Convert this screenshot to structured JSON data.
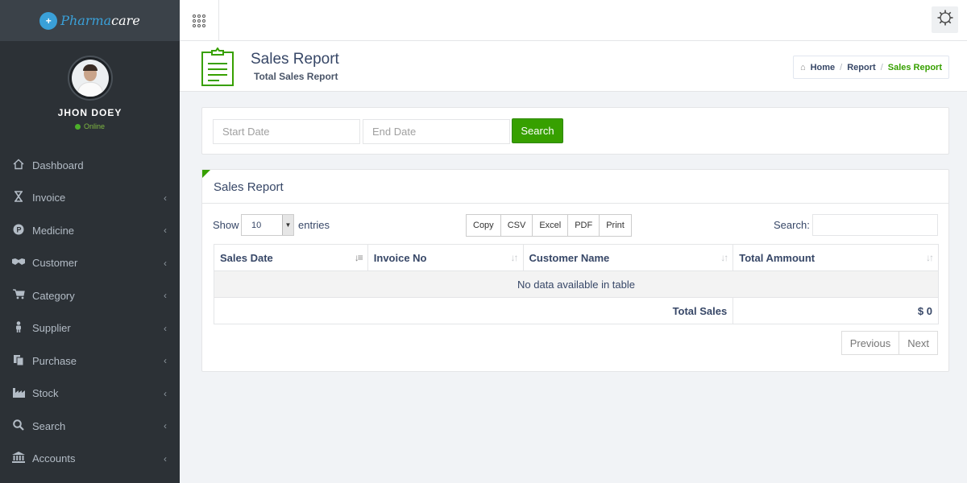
{
  "app": {
    "logo_part1": "Pharma",
    "logo_part2": "care",
    "accent_color": "#37a000"
  },
  "user": {
    "name": "JHON DOEY",
    "status": "Online"
  },
  "sidebar": {
    "items": [
      {
        "label": "Dashboard",
        "icon": "home-icon",
        "has_submenu": false
      },
      {
        "label": "Invoice",
        "icon": "hourglass-icon",
        "has_submenu": true
      },
      {
        "label": "Medicine",
        "icon": "pharmacy-icon",
        "has_submenu": true
      },
      {
        "label": "Customer",
        "icon": "handshake-icon",
        "has_submenu": true
      },
      {
        "label": "Category",
        "icon": "cart-icon",
        "has_submenu": true
      },
      {
        "label": "Supplier",
        "icon": "person-icon",
        "has_submenu": true
      },
      {
        "label": "Purchase",
        "icon": "copy-icon",
        "has_submenu": true
      },
      {
        "label": "Stock",
        "icon": "factory-icon",
        "has_submenu": true
      },
      {
        "label": "Search",
        "icon": "search-icon",
        "has_submenu": true
      },
      {
        "label": "Accounts",
        "icon": "bank-icon",
        "has_submenu": true
      }
    ]
  },
  "header": {
    "title": "Sales Report",
    "subtitle": "Total Sales Report",
    "breadcrumb": {
      "home": "Home",
      "section": "Report",
      "current": "Sales Report"
    }
  },
  "filter": {
    "start_placeholder": "Start Date",
    "end_placeholder": "End Date",
    "search_label": "Search"
  },
  "report": {
    "title": "Sales Report",
    "show_label": "Show",
    "entries_value": "10",
    "entries_label": "entries",
    "export_buttons": [
      "Copy",
      "CSV",
      "Excel",
      "PDF",
      "Print"
    ],
    "search_label": "Search:",
    "columns": [
      "Sales Date",
      "Invoice No",
      "Customer Name",
      "Total Ammount"
    ],
    "empty_message": "No data available in table",
    "total_label": "Total Sales",
    "total_value": "$ 0",
    "pager": {
      "previous": "Previous",
      "next": "Next"
    }
  }
}
